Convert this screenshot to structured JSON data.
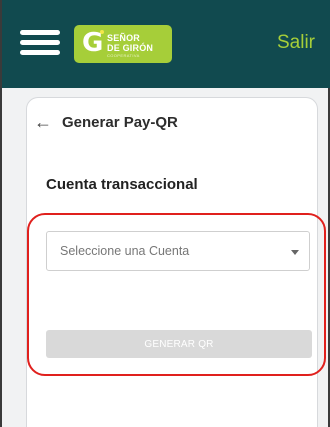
{
  "header": {
    "menu_icon": "hamburger-icon",
    "brand": {
      "line1": "SEÑOR",
      "line2": "DE GIRÓN",
      "line3": "COOPERATIVA"
    },
    "logout_label": "Salir"
  },
  "page": {
    "back_icon": "arrow-left-icon",
    "title": "Generar Pay-QR"
  },
  "form": {
    "section_title": "Cuenta transaccional",
    "account_select": {
      "placeholder": "Seleccione una Cuenta",
      "caret_icon": "caret-down-icon"
    },
    "generate_button_label": "GENERAR QR"
  },
  "colors": {
    "topbar": "#114a4f",
    "brand_green": "#a6ce39",
    "annotation_red": "#e0201d",
    "disabled_button": "#d9d9d9"
  }
}
